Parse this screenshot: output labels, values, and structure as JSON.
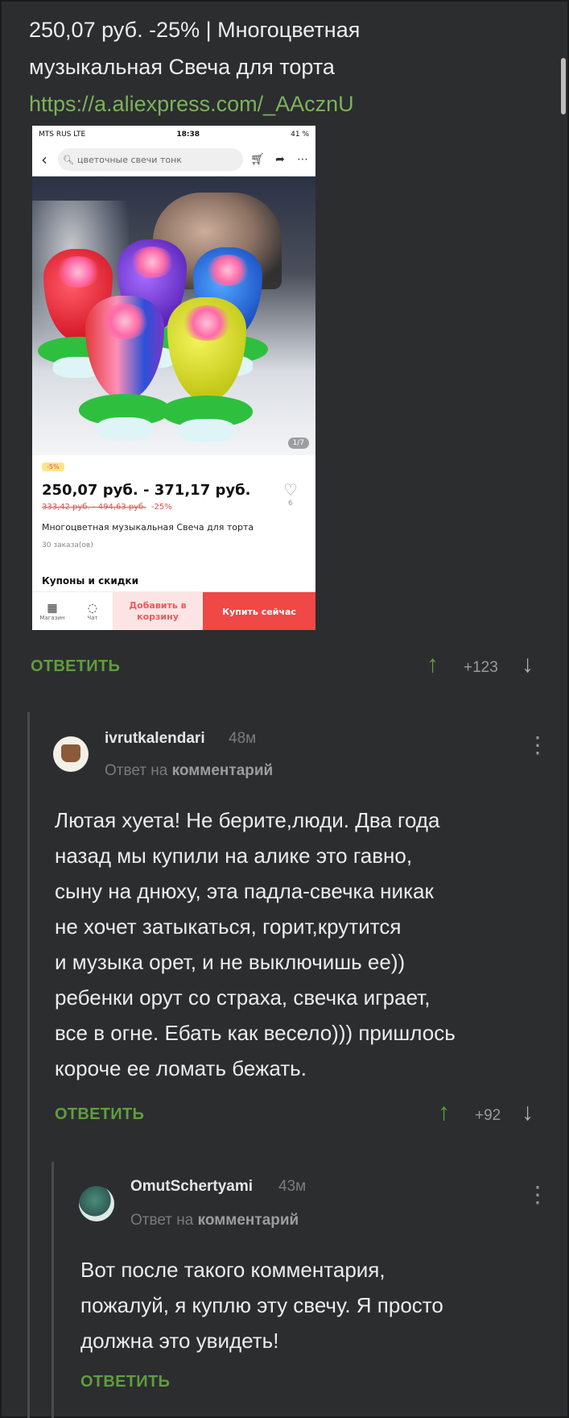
{
  "post": {
    "line1": "250,07 руб. -25% | Многоцветная",
    "line2": "музыкальная Свеча для торта",
    "link": "https://a.aliexpress.com/_AAcznU"
  },
  "screenshot": {
    "carrier": "MTS RUS  LTE",
    "time": "18:38",
    "battery": "41 %",
    "search_text": "цветочные свечи тонк",
    "image_counter": "1/7",
    "discount_badge": "-5%",
    "price": "250,07 руб. - 371,17 руб.",
    "old_price": "333,42 руб. - 494,63 руб.",
    "discount": "-25%",
    "likes": "6",
    "title": "Многоцветная музыкальная Свеча для торта",
    "orders": "30 заказа(ов)",
    "coupons": "Купоны и скидки",
    "store_label": "Магазин",
    "chat_label": "Чат",
    "add_to_cart": "Добавить в корзину",
    "buy_now": "Купить сейчас"
  },
  "post_actions": {
    "reply": "ОТВЕТИТЬ",
    "score": "+123"
  },
  "comments": [
    {
      "user": "ivrutkalendari",
      "time": "48м",
      "reply_prefix": "Ответ на",
      "reply_target": "комментарий",
      "lines": [
        "Лютая хуета! Не берите,люди. Два года",
        "назад мы купили на алике это гавно,",
        "сыну на днюху, эта падла-свечка никак",
        "не хочет затыкаться, горит,крутится",
        "и музыка орет, и не выключишь ее))",
        "ребенки орут со страха, свечка играет,",
        "все в огне. Ебать как весело))) пришлось",
        "короче ее ломать бежать."
      ],
      "reply": "ОТВЕТИТЬ",
      "score": "+92"
    },
    {
      "user": "OmutSchertyami",
      "time": "43м",
      "reply_prefix": "Ответ на",
      "reply_target": "комментарий",
      "lines": [
        "Вот после такого комментария,",
        "пожалуй, я куплю эту свечу. Я просто",
        "должна это увидеть!"
      ],
      "reply": "ОТВЕТИТЬ"
    }
  ],
  "colors": {
    "background": "#2c2d2f",
    "accent_green": "#5f9e3d",
    "link_green": "#7cb35a"
  },
  "icons": [
    "up-arrow-icon",
    "down-arrow-icon",
    "more-vertical-icon",
    "back-chevron-icon",
    "search-icon",
    "cart-icon",
    "share-icon",
    "heart-icon",
    "store-icon",
    "chat-icon"
  ]
}
